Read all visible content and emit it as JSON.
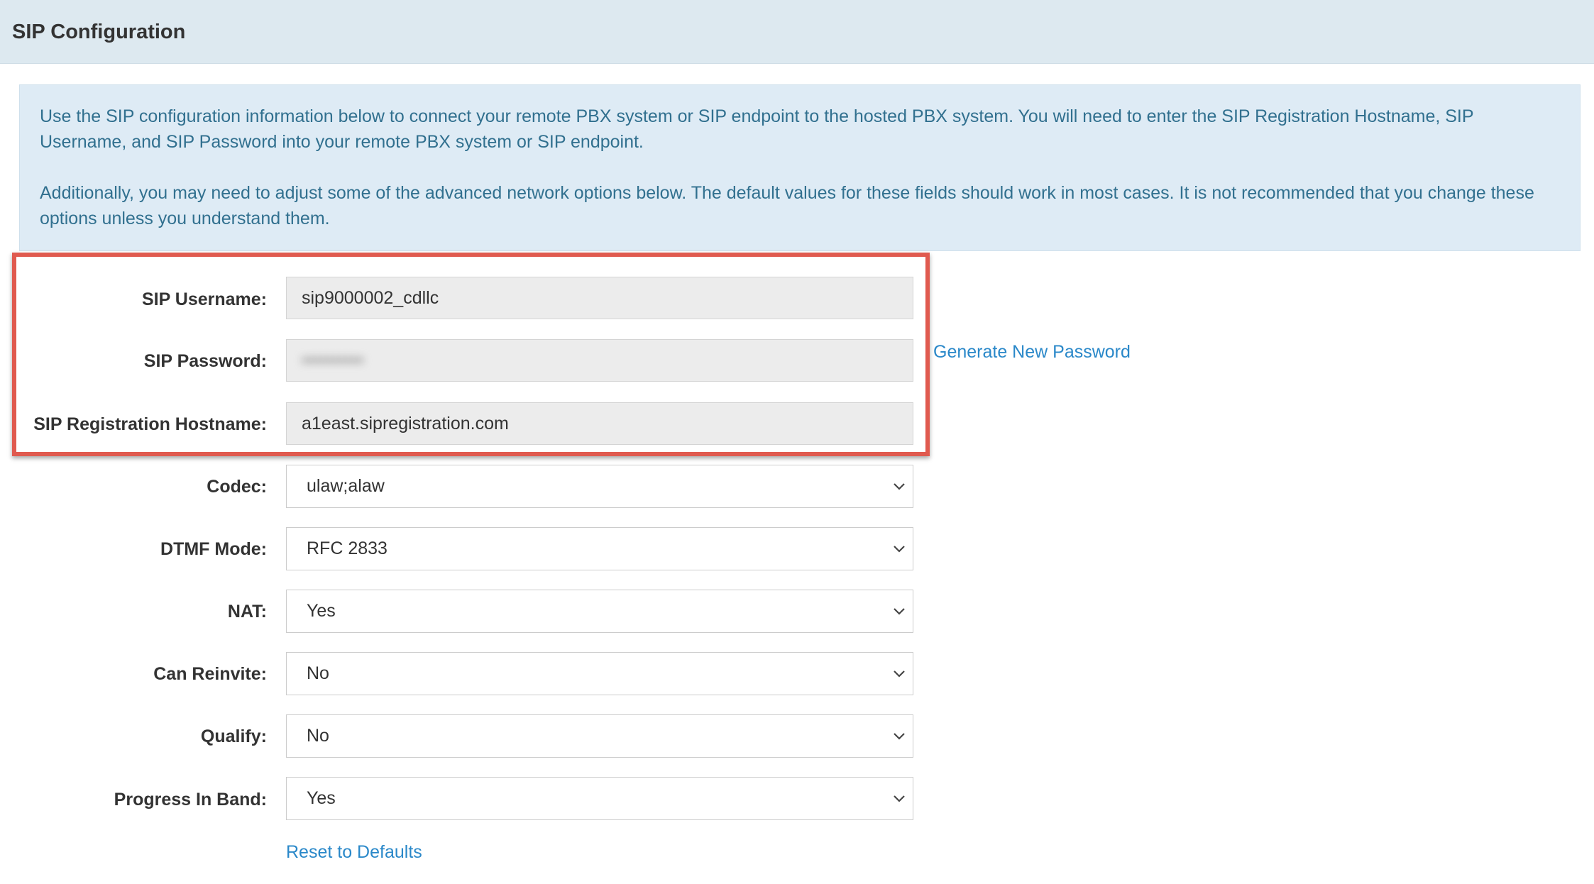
{
  "header": {
    "title": "SIP Configuration"
  },
  "info": {
    "paragraph1": "Use the SIP configuration information below to connect your remote PBX system or SIP endpoint to the hosted PBX system. You will need to enter the SIP Registration Hostname, SIP Username, and SIP Password into your remote PBX system or SIP endpoint.",
    "paragraph2": "Additionally, you may need to adjust some of the advanced network options below. The default values for these fields should work in most cases. It is not recommended that you change these options unless you understand them."
  },
  "credentials": {
    "username_label": "SIP Username:",
    "username_value": "sip9000002_cdllc",
    "password_label": "SIP Password:",
    "password_value": "••••••••••",
    "hostname_label": "SIP Registration Hostname:",
    "hostname_value": "a1east.sipregistration.com",
    "generate_link": "Generate New Password"
  },
  "options": [
    {
      "label": "Codec:",
      "value": "ulaw;alaw"
    },
    {
      "label": "DTMF Mode:",
      "value": "RFC 2833"
    },
    {
      "label": "NAT:",
      "value": "Yes"
    },
    {
      "label": "Can Reinvite:",
      "value": "No"
    },
    {
      "label": "Qualify:",
      "value": "No"
    },
    {
      "label": "Progress In Band:",
      "value": "Yes"
    }
  ],
  "reset_link": "Reset to Defaults",
  "colors": {
    "header_bg": "#dde9f0",
    "info_bg": "#deebf5",
    "info_text": "#31708f",
    "highlight": "#e05a4f",
    "link": "#2a88c9"
  },
  "icons": {
    "select_arrow": "chevron-down-icon"
  }
}
